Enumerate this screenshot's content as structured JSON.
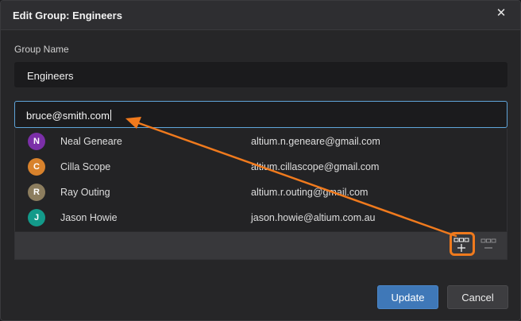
{
  "dialog": {
    "title": "Edit Group: Engineers",
    "close_glyph": "✕"
  },
  "group": {
    "label": "Group Name",
    "value": "Engineers"
  },
  "member_input": {
    "value": "bruce@smith.com"
  },
  "members": [
    {
      "initial": "N",
      "name": "Neal Geneare",
      "email": "altium.n.geneare@gmail.com",
      "color": "#7b2fa8"
    },
    {
      "initial": "C",
      "name": "Cilla Scope",
      "email": "altium.cillascope@gmail.com",
      "color": "#d8822c"
    },
    {
      "initial": "R",
      "name": "Ray Outing",
      "email": "altium.r.outing@gmail.com",
      "color": "#8c7d5e"
    },
    {
      "initial": "J",
      "name": "Jason Howie",
      "email": "jason.howie@altium.com.au",
      "color": "#139a8a"
    }
  ],
  "toolbar": {
    "add_icon": "add-row-icon",
    "remove_icon": "remove-row-icon"
  },
  "buttons": {
    "update": "Update",
    "cancel": "Cancel"
  },
  "annotation": {
    "color": "#f07a1d"
  }
}
